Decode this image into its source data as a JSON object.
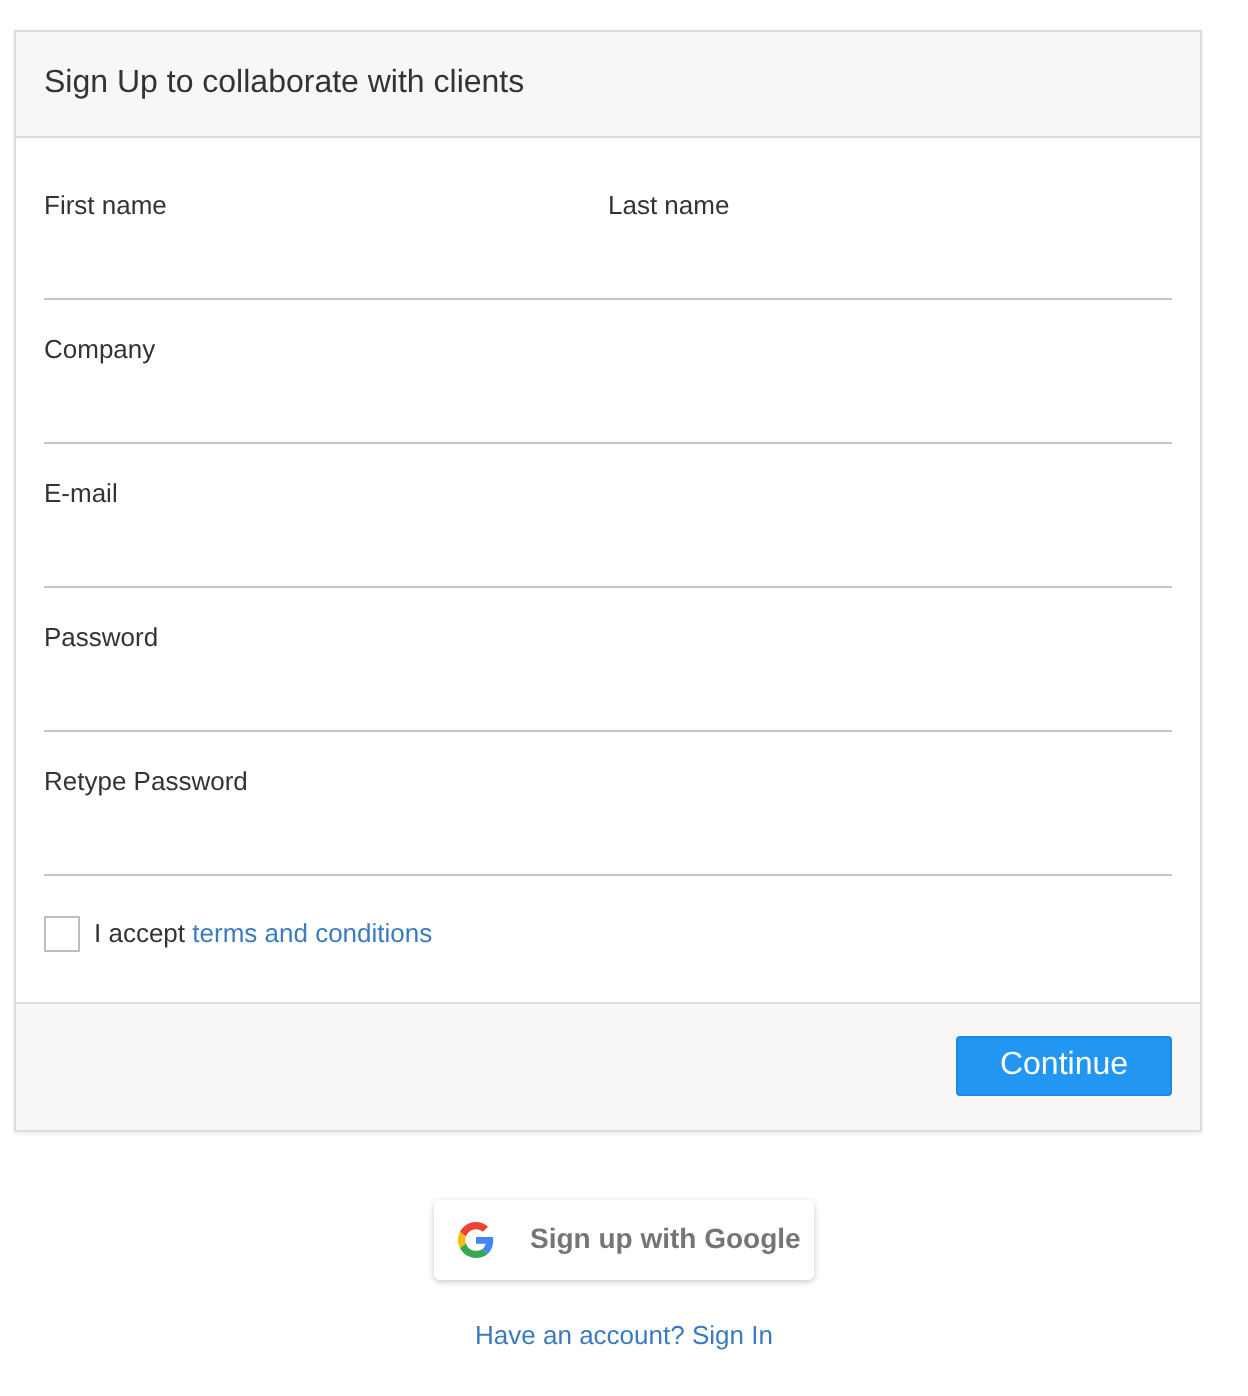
{
  "header": {
    "title": "Sign Up to collaborate with clients"
  },
  "rows": [
    {
      "fields": [
        {
          "label": "First name"
        },
        {
          "label": "Last name"
        }
      ]
    },
    {
      "fields": [
        {
          "label": "Company"
        }
      ]
    },
    {
      "fields": [
        {
          "label": "E-mail"
        }
      ]
    },
    {
      "fields": [
        {
          "label": "Password"
        }
      ]
    },
    {
      "fields": [
        {
          "label": "Retype Password"
        }
      ]
    }
  ],
  "terms": {
    "checked": false,
    "text": "I accept",
    "link": "terms and conditions"
  },
  "footer": {
    "continue_button": "Continue"
  },
  "google_button": "Sign up with Google",
  "signin_link": "Have an account? Sign In"
}
